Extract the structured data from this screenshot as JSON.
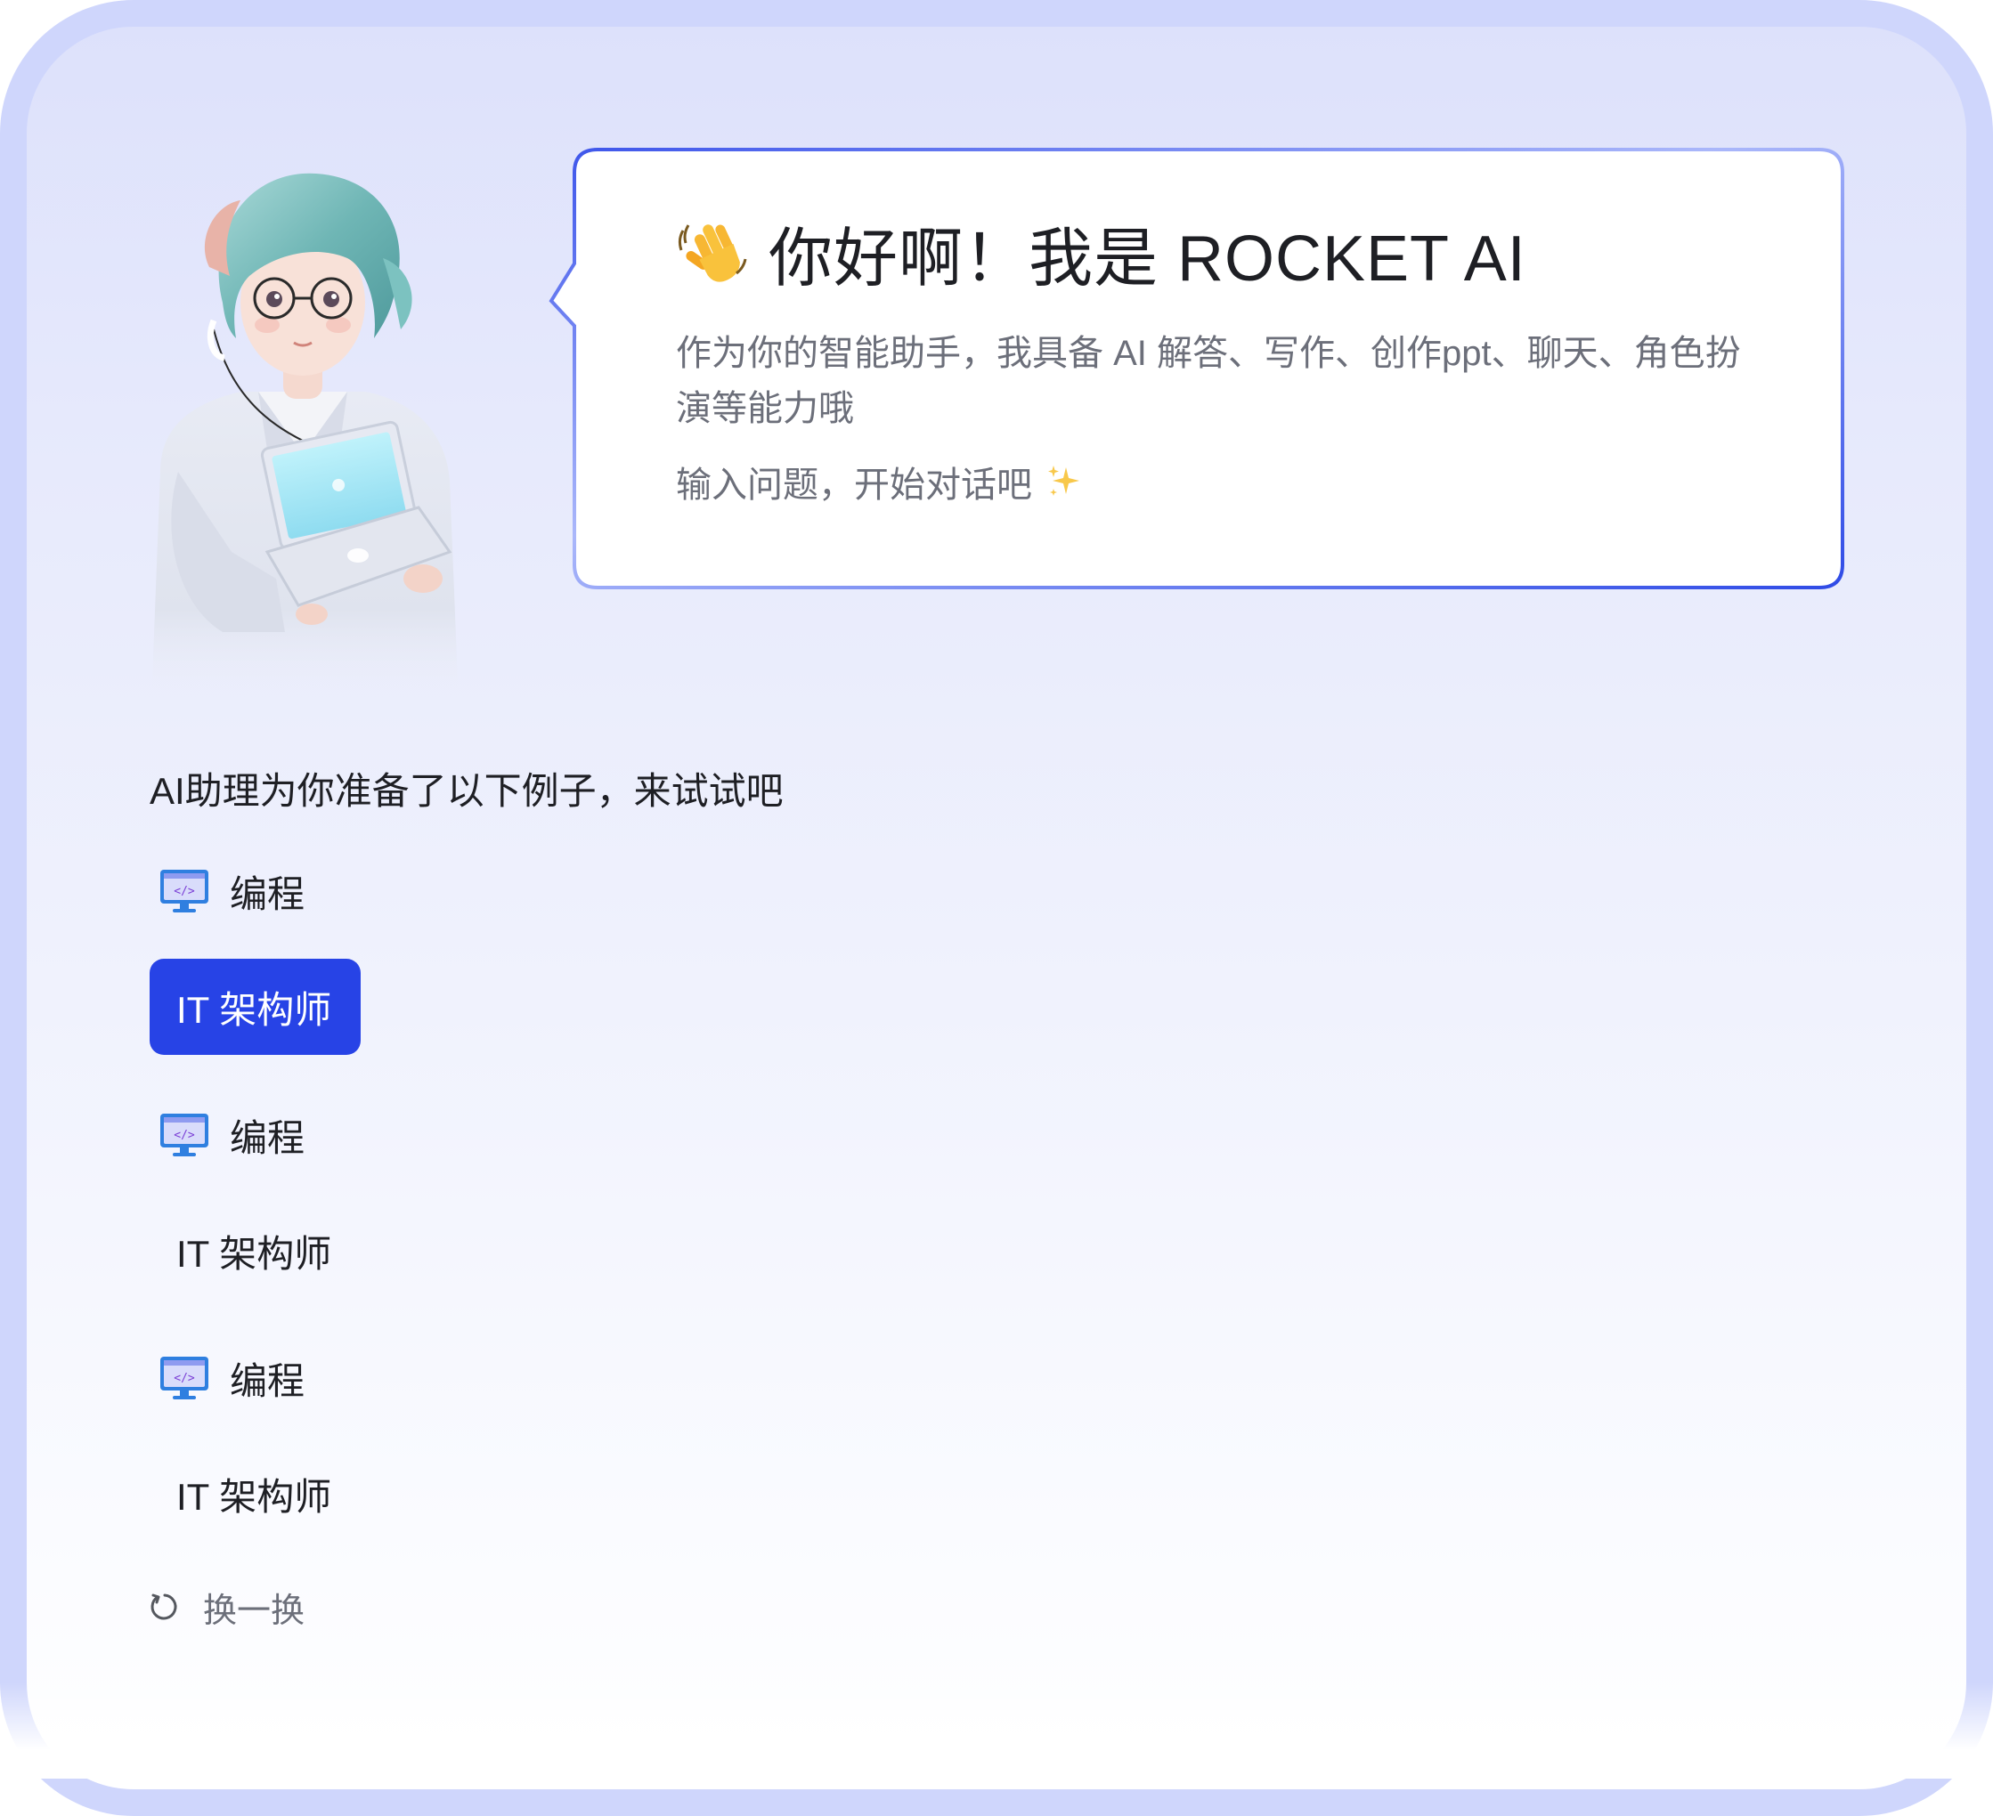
{
  "greeting": {
    "title": "你好啊！我是 ROCKET AI",
    "description": "作为你的智能助手，我具备 AI 解答、写作、创作ppt、聊天、角色扮演等能力哦",
    "prompt": "输入问题，开始对话吧"
  },
  "examples": {
    "heading": "AI助理为你准备了以下例子，来试试吧",
    "items": [
      {
        "label": "编程",
        "icon": "monitor-code-icon"
      },
      {
        "label": "IT 架构师",
        "active": true
      },
      {
        "label": "编程",
        "icon": "monitor-code-icon"
      },
      {
        "label": "IT 架构师"
      },
      {
        "label": "编程",
        "icon": "monitor-code-icon"
      },
      {
        "label": "IT 架构师"
      }
    ],
    "refresh_label": "换一换"
  },
  "icons": {
    "greeting": "waving-hand-icon",
    "prompt": "sparkles-icon",
    "refresh": "refresh-icon"
  },
  "colors": {
    "accent": "#2743e6",
    "frame_border": "#cfd6fc",
    "text_primary": "#1e1f24",
    "text_secondary": "#6c6f7a"
  }
}
